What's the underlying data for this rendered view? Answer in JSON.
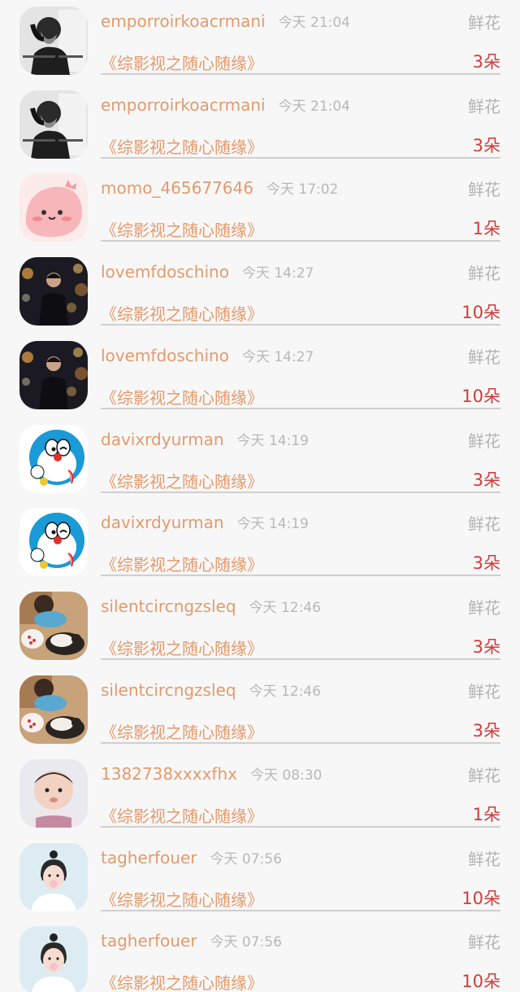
{
  "gift_list": {
    "items": [
      {
        "username": "emporroirkoacrmani",
        "time": "今天 21:04",
        "gift_type": "鲜花",
        "title": "《综影视之随心随缘》",
        "count": "3朵",
        "avatar": "avatar-bw-man"
      },
      {
        "username": "emporroirkoacrmani",
        "time": "今天 21:04",
        "gift_type": "鲜花",
        "title": "《综影视之随心随缘》",
        "count": "3朵",
        "avatar": "avatar-bw-man"
      },
      {
        "username": "momo_465677646",
        "time": "今天 17:02",
        "gift_type": "鲜花",
        "title": "《综影视之随心随缘》",
        "count": "1朵",
        "avatar": "avatar-pink-cartoon"
      },
      {
        "username": "lovemfdoschino",
        "time": "今天 14:27",
        "gift_type": "鲜花",
        "title": "《综影视之随心随缘》",
        "count": "10朵",
        "avatar": "avatar-night-man"
      },
      {
        "username": "lovemfdoschino",
        "time": "今天 14:27",
        "gift_type": "鲜花",
        "title": "《综影视之随心随缘》",
        "count": "10朵",
        "avatar": "avatar-night-man"
      },
      {
        "username": "davixrdyurman",
        "time": "今天 14:19",
        "gift_type": "鲜花",
        "title": "《综影视之随心随缘》",
        "count": "3朵",
        "avatar": "avatar-doraemon"
      },
      {
        "username": "davixrdyurman",
        "time": "今天 14:19",
        "gift_type": "鲜花",
        "title": "《综影视之随心随缘》",
        "count": "3朵",
        "avatar": "avatar-doraemon"
      },
      {
        "username": "silentcircngzsleq",
        "time": "今天 12:46",
        "gift_type": "鲜花",
        "title": "《综影视之随心随缘》",
        "count": "3朵",
        "avatar": "avatar-child-cat"
      },
      {
        "username": "silentcircngzsleq",
        "time": "今天 12:46",
        "gift_type": "鲜花",
        "title": "《综影视之随心随缘》",
        "count": "3朵",
        "avatar": "avatar-child-cat"
      },
      {
        "username": "1382738xxxxfhx",
        "time": "今天 08:30",
        "gift_type": "鲜花",
        "title": "《综影视之随心随缘》",
        "count": "1朵",
        "avatar": "avatar-baby"
      },
      {
        "username": "tagherfouer",
        "time": "今天 07:56",
        "gift_type": "鲜花",
        "title": "《综影视之随心随缘》",
        "count": "10朵",
        "avatar": "avatar-girl"
      },
      {
        "username": "tagherfouer",
        "time": "今天 07:56",
        "gift_type": "鲜花",
        "title": "《综影视之随心随缘》",
        "count": "10朵",
        "avatar": "avatar-girl"
      }
    ]
  },
  "colors": {
    "username": "#e49a6c",
    "count": "#d23b3b",
    "muted": "#b3b3b3",
    "background": "#f7f7f7"
  }
}
